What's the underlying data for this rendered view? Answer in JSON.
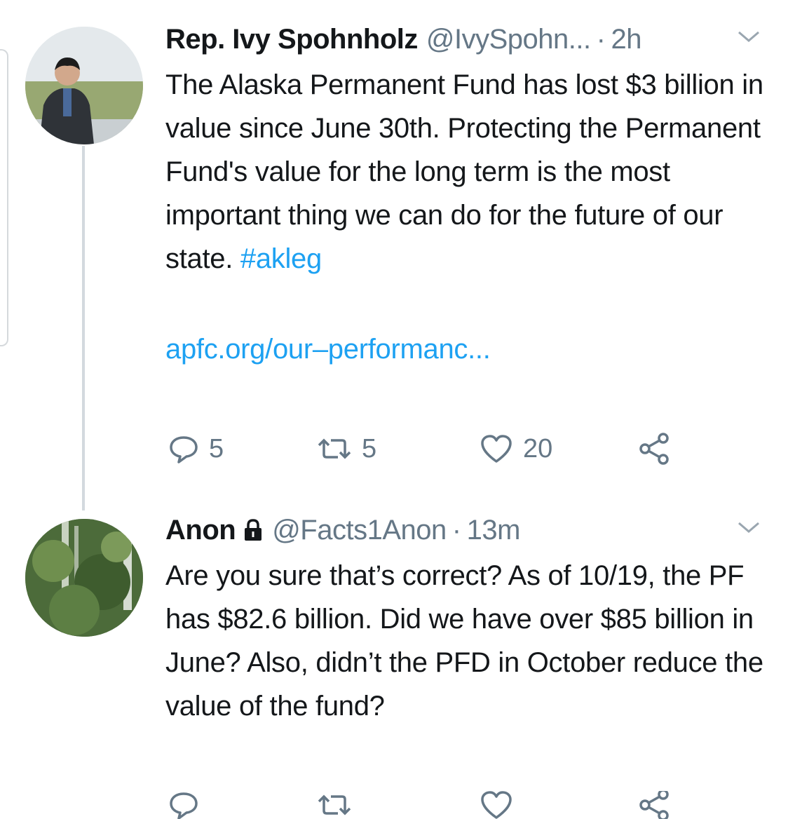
{
  "tweets": [
    {
      "name": "Rep. Ivy Spohnholz",
      "handle": "@IvySpohn...",
      "separator": "·",
      "time": "2h",
      "text": "The Alaska Permanent Fund has lost $3 billion in value since June 30th. Protecting the Permanent Fund's value for the long term is the most important thing we can do for the future of our state.",
      "hashtag": "#akleg",
      "link": "apfc.org/our–performanc...",
      "replies": "5",
      "retweets": "5",
      "likes": "20"
    },
    {
      "name": "Anon",
      "handle": "@Facts1Anon",
      "separator": "·",
      "time": "13m",
      "text": "Are you sure that’s correct? As of 10/19, the PF has $82.6 billion. Did we have over $85 billion in June? Also, didn’t the PFD in October reduce the value of the fund?"
    }
  ],
  "icons": {
    "reply": "reply-icon",
    "retweet": "retweet-icon",
    "like": "heart-icon",
    "share": "share-icon",
    "more": "chevron-down-icon",
    "protected": "lock-icon"
  },
  "colors": {
    "link": "#1da1f2",
    "muted": "#657786",
    "text": "#14171a"
  }
}
